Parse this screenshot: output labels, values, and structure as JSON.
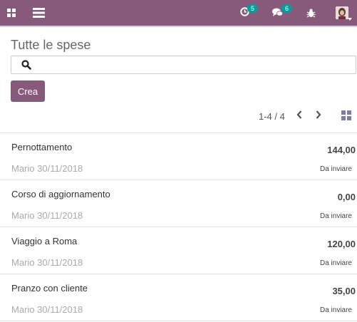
{
  "topbar": {
    "activity_count": "5",
    "messages_count": "6"
  },
  "control_panel": {
    "title": "Tutte le spese",
    "search_placeholder": "",
    "create_label": "Crea",
    "pager_value": "1-4 / 4"
  },
  "expenses": [
    {
      "name": "Pernottamento",
      "amount": "144,00",
      "employee_date": "Mario 30/11/2018",
      "status": "Da inviare"
    },
    {
      "name": "Corso di aggiornamento",
      "amount": "0,00",
      "employee_date": "Mario 30/11/2018",
      "status": "Da inviare"
    },
    {
      "name": "Viaggio a Roma",
      "amount": "120,00",
      "employee_date": "Mario 30/11/2018",
      "status": "Da inviare"
    },
    {
      "name": "Pranzo con cliente",
      "amount": "35,00",
      "employee_date": "Mario 30/11/2018",
      "status": "Da inviare"
    }
  ],
  "colors": {
    "brand": "#875a7b",
    "badge": "#00a09d",
    "view_switch_active": "#7c7bad"
  },
  "icons": {
    "apps": "apps-grid-icon",
    "menu": "hamburger-menu-icon",
    "activity": "clock-icon",
    "messages": "chat-bubbles-icon",
    "debug": "bug-icon",
    "search": "search-icon",
    "prev": "chevron-left-icon",
    "next": "chevron-right-icon",
    "kanban": "kanban-view-icon"
  }
}
